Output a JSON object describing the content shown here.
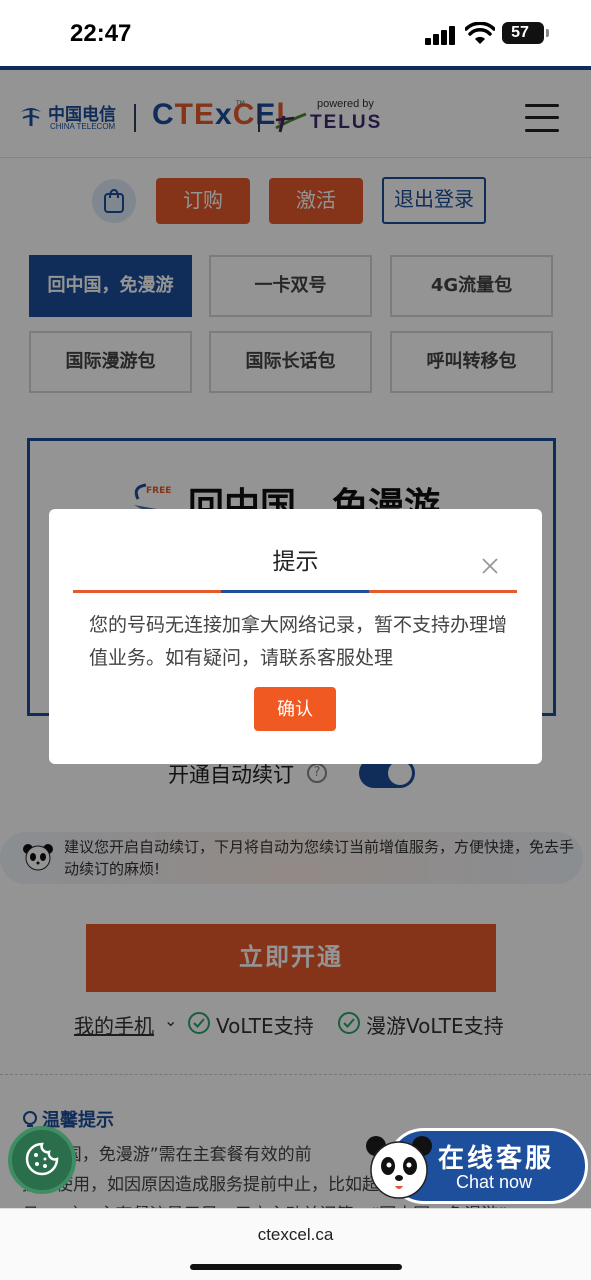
{
  "status_bar": {
    "time": "22:47",
    "battery": "57"
  },
  "header": {
    "ct_logo_cn": "中国电信",
    "ct_logo_en": "CHINA TELECOM",
    "ctexcel_logo": "CTExCEl",
    "powered_by": "powered by",
    "telus": "TELUS",
    "menu_icon": "hamburger-menu-icon"
  },
  "actions": {
    "cart_icon": "shopping-bag-icon",
    "order": "订购",
    "activate": "激活",
    "logout": "退出登录"
  },
  "tiles": [
    {
      "label": "回中国，免漫游",
      "active": true
    },
    {
      "label": "一卡双号",
      "active": false
    },
    {
      "label": "4G流量包",
      "active": false
    },
    {
      "label": "国际漫游包",
      "active": false
    },
    {
      "label": "国际长话包",
      "active": false
    },
    {
      "label": "呼叫转移包",
      "active": false
    }
  ],
  "product": {
    "badge": "FREE",
    "title": "回中国，免漫游"
  },
  "auto_renew": {
    "label": "开通自动续订",
    "help": "?",
    "enabled": true
  },
  "tip_banner": {
    "text": "建议您开启自动续订，下月将自动为您续订当前增值服务，方便快捷，免去手动续订的麻烦!"
  },
  "submit": {
    "label": "立即开通"
  },
  "phone_row": {
    "my_phone": "我的手机",
    "volte": "VoLTE支持",
    "roam_volte": "漫游VoLTE支持"
  },
  "notice": {
    "title": "温馨提示",
    "line1": "“回中国，免漫游”需在主套餐有效的前",
    "line2": "提下使用，如因原因造成服务提前中止，比如超过单",
    "line3": "月……），主套餐流量用尽，用户主动关闭等，“回中国，免漫游”"
  },
  "modal": {
    "title": "提示",
    "body": "您的号码无连接加拿大网络记录，暂不支持办理增值业务。如有疑问，请联系客服处理",
    "confirm": "确认",
    "rule_colors": [
      "#e55a2b",
      "#1d4f9c",
      "#e55a2b"
    ]
  },
  "chat": {
    "cn": "在线客服",
    "en": "Chat now"
  },
  "cookie_icon": "cookie-icon",
  "url": "ctexcel.ca",
  "colors": {
    "brand_blue": "#1d4f9c",
    "brand_orange": "#e55a2b"
  }
}
